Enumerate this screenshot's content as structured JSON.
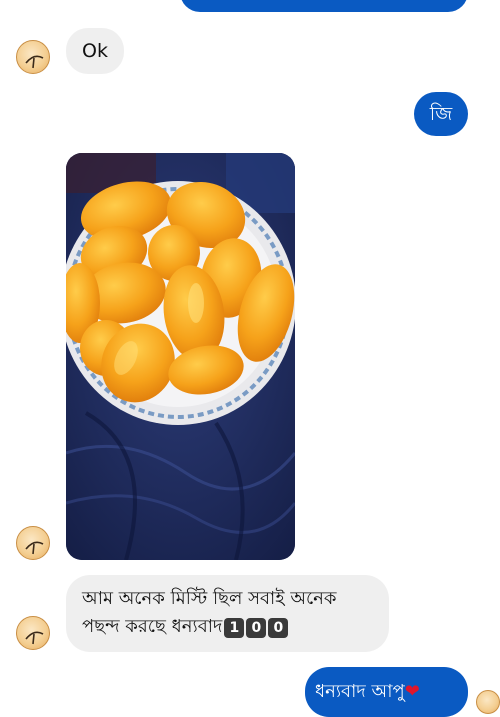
{
  "colors": {
    "outgoing_bubble": "#0a5ac2",
    "incoming_bubble": "#efefef",
    "background": "#ffffff"
  },
  "messages": {
    "ok_text": "Ok",
    "ji_text": "জি",
    "long_text": "আম অনেক মিস্টি ছিল সবাই অনেক পছন্দ করছে ধন্যবাদ",
    "long_badges": [
      "1",
      "0",
      "0"
    ],
    "bottom_text": "ধন্যবাদ আপু",
    "bottom_emoji": "heart-emoji"
  },
  "photo": {
    "subject": "plate-of-sliced-mangoes"
  },
  "avatars": [
    "user-avatar",
    "user-avatar",
    "user-avatar",
    "user-avatar"
  ]
}
